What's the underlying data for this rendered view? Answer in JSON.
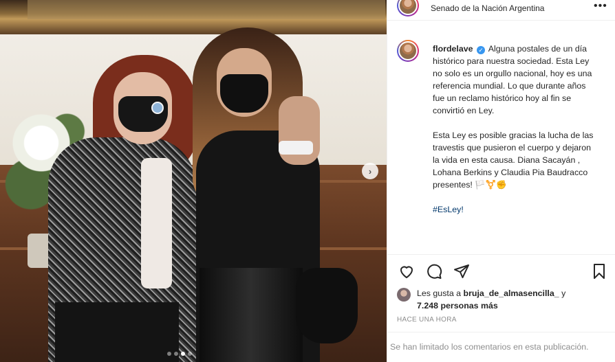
{
  "post": {
    "location": "Senado de la Nación Argentina",
    "more_label": "•••",
    "username": "flordelave",
    "verified_mark": "✓",
    "caption_p1": "Alguna postales de un día histórico para nuestra sociedad. Esta Ley no solo es un orgullo nacional, hoy es una referencia mundial. Lo que durante años fue un reclamo histórico hoy al fin se convirtió en Ley.",
    "caption_p2": "Esta Ley es posible gracias la lucha de las travestis que pusieron el cuerpo y dejaron la vida en esta causa. Diana Sacayán , Lohana Berkins y Claudia Pia Baudracco presentes! 🏳️⚧️✊",
    "hashtag": "#EsLey!",
    "likes_prefix": "Les gusta a",
    "liker": "bruja_de_almasencilla_",
    "likes_joiner": "y",
    "likes_count": "7.248 personas más",
    "timestamp": "HACE UNA HORA",
    "comments_limited": "Se han limitado los comentarios en esta publicación."
  },
  "carousel": {
    "next_label": "›",
    "dots_total": 4,
    "dot_active_index": 2
  },
  "icons": {
    "heart": "heart-icon",
    "comment": "comment-icon",
    "share": "share-icon",
    "save": "bookmark-icon",
    "next": "chevron-right-icon"
  },
  "colors": {
    "text": "#262626",
    "muted": "#8e8e8e",
    "link": "#00376b",
    "verified": "#3897f0"
  }
}
